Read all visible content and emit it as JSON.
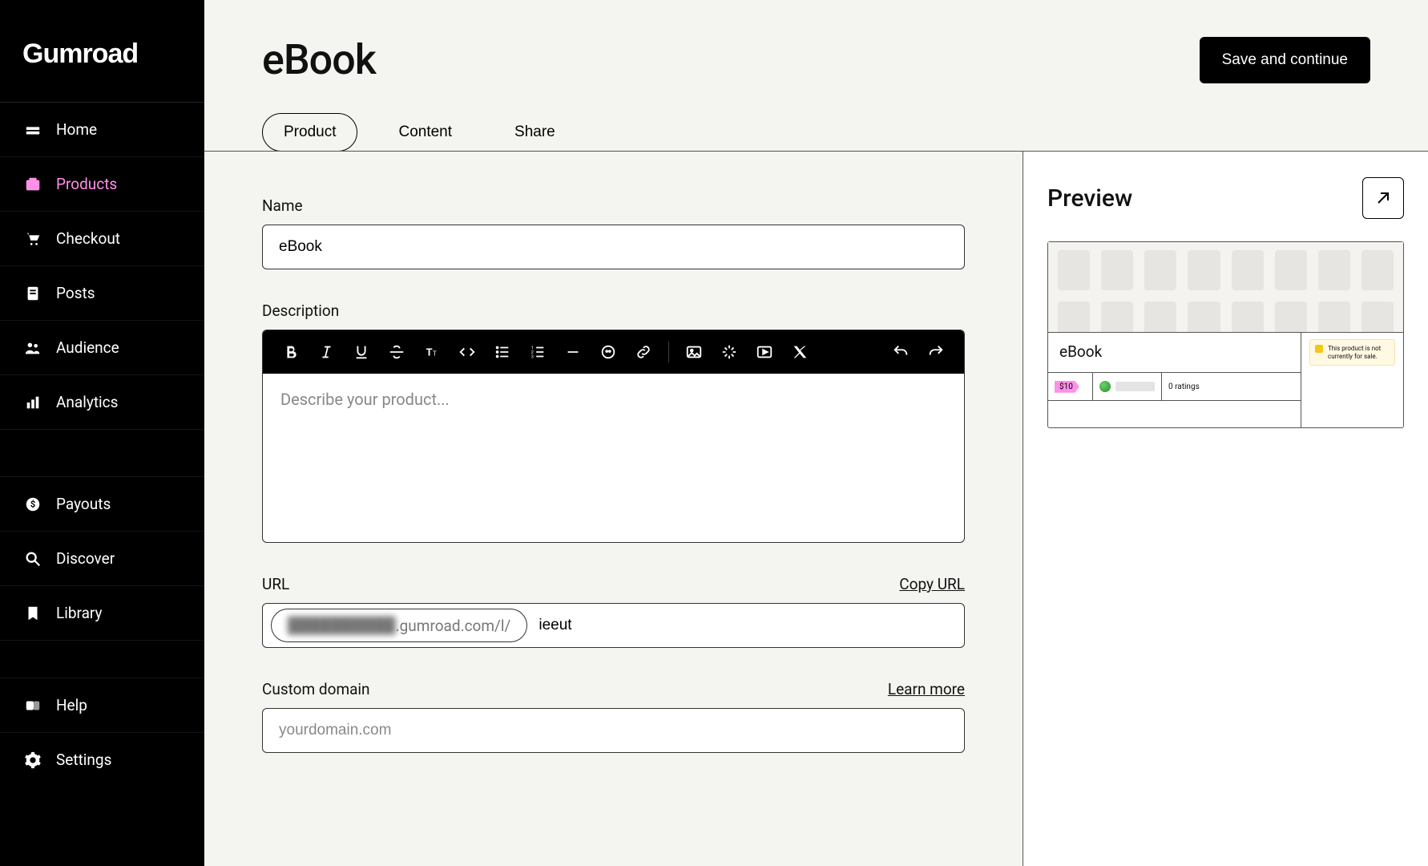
{
  "brand": {
    "name": "Gumroad"
  },
  "sidebar": {
    "items": [
      {
        "label": "Home"
      },
      {
        "label": "Products"
      },
      {
        "label": "Checkout"
      },
      {
        "label": "Posts"
      },
      {
        "label": "Audience"
      },
      {
        "label": "Analytics"
      }
    ],
    "secondary": [
      {
        "label": "Payouts"
      },
      {
        "label": "Discover"
      },
      {
        "label": "Library"
      }
    ],
    "footer": [
      {
        "label": "Help"
      },
      {
        "label": "Settings"
      }
    ]
  },
  "header": {
    "title": "eBook",
    "save_label": "Save and continue",
    "tabs": [
      {
        "label": "Product",
        "active": true
      },
      {
        "label": "Content",
        "active": false
      },
      {
        "label": "Share",
        "active": false
      }
    ]
  },
  "form": {
    "name": {
      "label": "Name",
      "value": "eBook"
    },
    "description": {
      "label": "Description",
      "placeholder": "Describe your product..."
    },
    "url": {
      "label": "URL",
      "copy_label": "Copy URL",
      "prefix_hidden": "██████████",
      "prefix_visible": ".gumroad.com/l/",
      "slug": "ieeut"
    },
    "custom_domain": {
      "label": "Custom domain",
      "learn_more": "Learn more",
      "placeholder": "yourdomain.com"
    }
  },
  "preview": {
    "title": "Preview",
    "card": {
      "title": "eBook",
      "warning": "This product is not currently for sale.",
      "price": "$10",
      "ratings": "0 ratings"
    }
  }
}
